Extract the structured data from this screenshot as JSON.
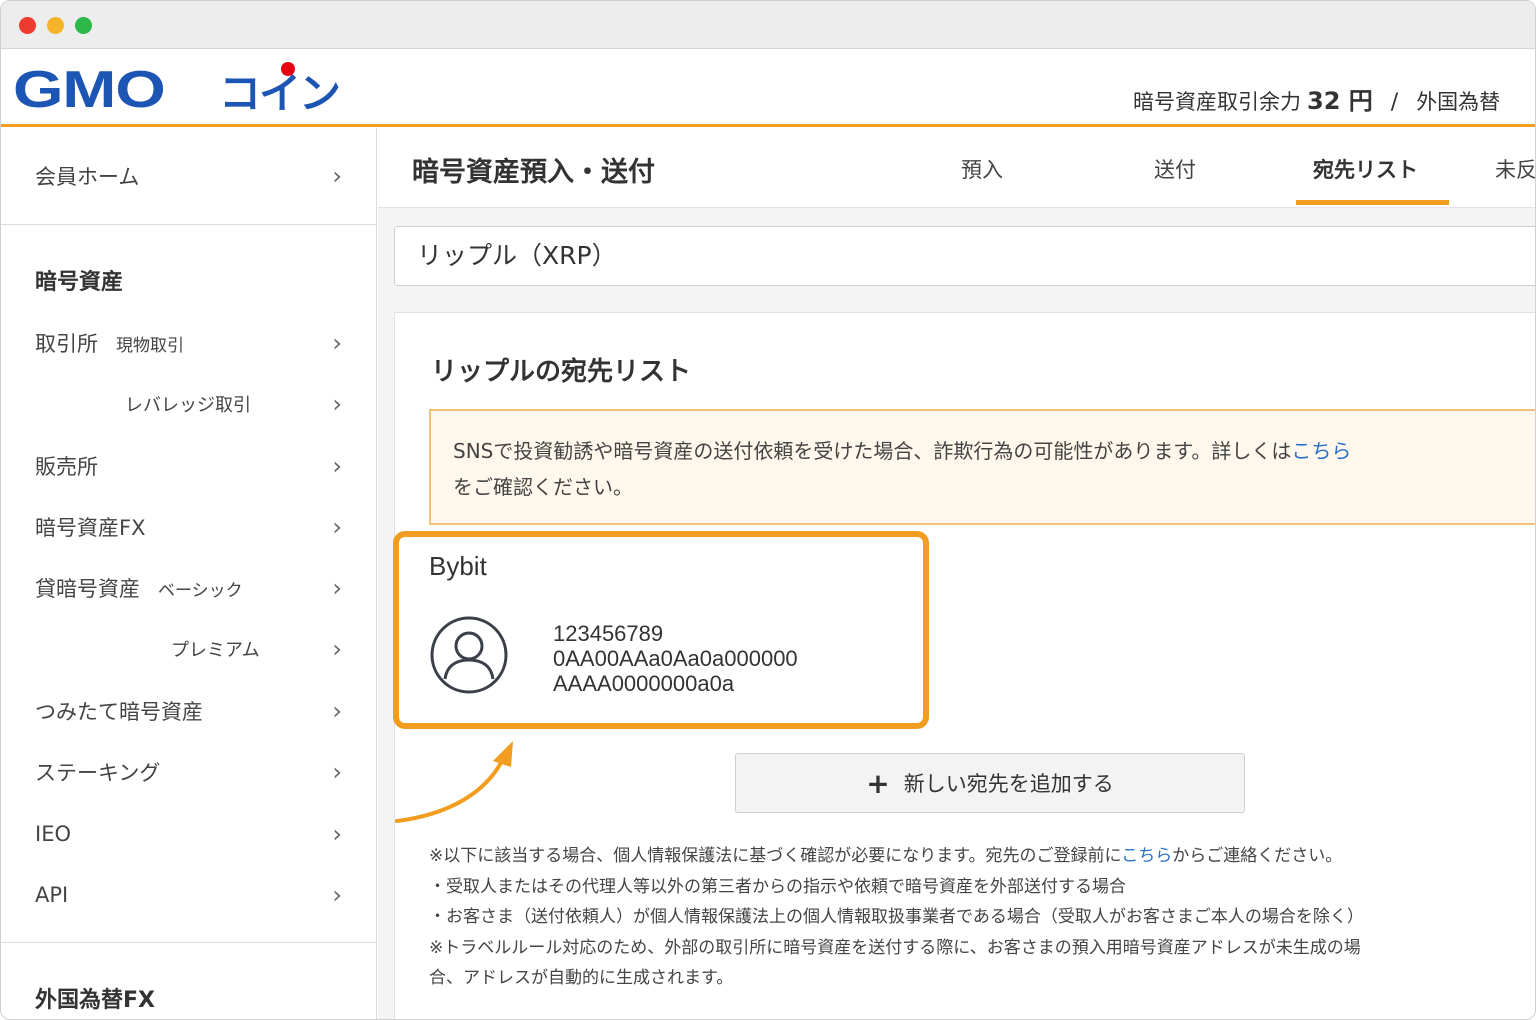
{
  "header": {
    "logo_text_latin": "GMO",
    "logo_text_kana": "コイン",
    "balance_label": "暗号資産取引余力",
    "balance_value": "32 円",
    "separator": "/",
    "fx_label": "外国為替"
  },
  "sidebar": {
    "member_home": "会員ホーム",
    "crypto_heading": "暗号資産",
    "exchange_label": "取引所",
    "spot_label": "現物取引",
    "leverage_label": "レバレッジ取引",
    "sales_label": "販売所",
    "crypto_fx": "暗号資産FX",
    "lending_label": "貸暗号資産",
    "lending_basic": "ベーシック",
    "lending_premium": "プレミアム",
    "tsumitate": "つみたて暗号資産",
    "staking": "ステーキング",
    "ieo": "IEO",
    "api": "API",
    "fx_heading": "外国為替FX",
    "chevron": "›"
  },
  "main": {
    "page_title": "暗号資産預入・送付",
    "tabs": [
      {
        "label": "預入"
      },
      {
        "label": "送付"
      },
      {
        "label": "宛先リスト"
      },
      {
        "label": "未反"
      }
    ],
    "coin_select": "リップル（XRP）",
    "panel_title": "リップルの宛先リスト",
    "warning_text_1": "SNSで投資勧誘や暗号資産の送付依頼を受けた場合、詐欺行為の可能性があります。詳しくは",
    "warning_link": "こちら",
    "warning_text_2": "をご確認ください。",
    "address_card": {
      "name": "Bybit",
      "lines": [
        "123456789",
        "0AA00AAa0Aa0a000000",
        "AAAA0000000a0a"
      ]
    },
    "add_button_icon": "+",
    "add_button": "新しい宛先を追加する",
    "notes": {
      "line1_pre": "※以下に該当する場合、個人情報保護法に基づく確認が必要になります。宛先のご登録前に",
      "line1_link": "こちら",
      "line1_post": "からご連絡ください。",
      "line2": "・受取人またはその代理人等以外の第三者からの指示や依頼で暗号資産を外部送付する場合",
      "line3": "・お客さま（送付依頼人）が個人情報保護法上の個人情報取扱事業者である場合（受取人がお客さまご本人の場合を除く）",
      "line4": "※トラベルルール対応のため、外部の取引所に暗号資産を送付する際に、お客さまの預入用暗号資産アドレスが未生成の場",
      "line5": "合、アドレスが自動的に生成されます。"
    }
  },
  "colors": {
    "accent": "#f29d1f",
    "brand": "#1d55b5",
    "link": "#2a70c9",
    "logo_dot": "#e60012"
  }
}
